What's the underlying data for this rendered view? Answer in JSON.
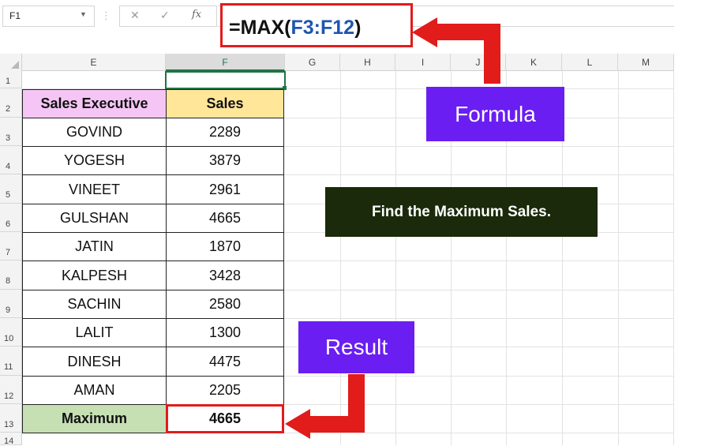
{
  "formula_bar": {
    "name_box": "F1",
    "fx_icon": "fx-icon",
    "cancel_icon": "cancel-icon",
    "enter_icon": "enter-icon",
    "formula_prefix": "=MAX(",
    "formula_range": "F3:F12",
    "formula_suffix": ")"
  },
  "columns": [
    "E",
    "F",
    "G",
    "H",
    "I",
    "J",
    "K",
    "L",
    "M"
  ],
  "rows": [
    "1",
    "2",
    "3",
    "4",
    "5",
    "6",
    "7",
    "8",
    "9",
    "10",
    "11",
    "12",
    "13",
    "14"
  ],
  "table": {
    "header_executive": "Sales Executive",
    "header_sales": "Sales",
    "rows": [
      {
        "name": "GOVIND",
        "sales": "2289"
      },
      {
        "name": "YOGESH",
        "sales": "3879"
      },
      {
        "name": "VINEET",
        "sales": "2961"
      },
      {
        "name": "GULSHAN",
        "sales": "4665"
      },
      {
        "name": "JATIN",
        "sales": "1870"
      },
      {
        "name": "KALPESH",
        "sales": "3428"
      },
      {
        "name": "SACHIN",
        "sales": "2580"
      },
      {
        "name": "LALIT",
        "sales": "1300"
      },
      {
        "name": "DINESH",
        "sales": "4475"
      },
      {
        "name": "AMAN",
        "sales": "2205"
      }
    ],
    "maximum_label": "Maximum",
    "maximum_value": "4665"
  },
  "callouts": {
    "formula": "Formula",
    "result": "Result",
    "note": "Find the Maximum Sales."
  },
  "colors": {
    "accent_purple": "#6a1ef2",
    "arrow_red": "#e21b1b",
    "header_pink": "#f5c6f5",
    "header_yellow": "#ffe699",
    "maximum_green": "#c6e0b4",
    "note_dark": "#1a2a0a",
    "range_blue": "#1e55b0"
  }
}
